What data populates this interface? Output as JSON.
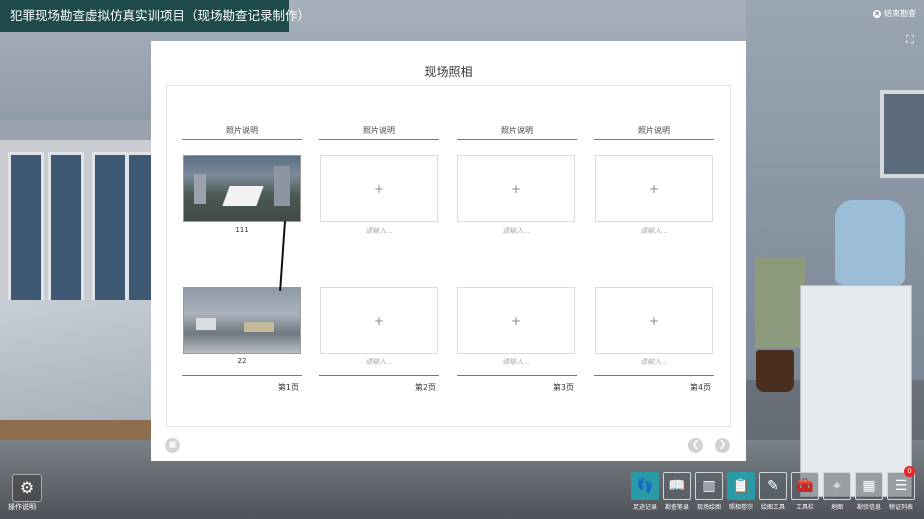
{
  "app": {
    "title": "犯罪现场勘查虚拟仿真实训项目（现场勘查记录制作）",
    "end_label": "结束勘查"
  },
  "panel": {
    "title": "现场照相",
    "columns": [
      {
        "header": "照片说明",
        "page": "第1页",
        "photos": [
          {
            "caption": "111",
            "filled": true
          },
          {
            "caption": "22",
            "filled": true
          }
        ]
      },
      {
        "header": "照片说明",
        "page": "第2页",
        "photos": [
          {
            "caption": "请输入...",
            "filled": false
          },
          {
            "caption": "请输入...",
            "filled": false
          }
        ]
      },
      {
        "header": "照片说明",
        "page": "第3页",
        "photos": [
          {
            "caption": "请输入...",
            "filled": false
          },
          {
            "caption": "请输入...",
            "filled": false
          }
        ]
      },
      {
        "header": "照片说明",
        "page": "第4页",
        "photos": [
          {
            "caption": "请输入...",
            "filled": false
          },
          {
            "caption": "请输入...",
            "filled": false
          }
        ]
      }
    ],
    "add_symbol": "+"
  },
  "bottom_left": {
    "label": "操作说明",
    "icon": "gear-icon"
  },
  "toolbar": [
    {
      "label": "足迹记录",
      "icon": "footprint-icon",
      "active": true
    },
    {
      "label": "勘查笔录",
      "icon": "book-icon",
      "active": false
    },
    {
      "label": "现场绘图",
      "icon": "chart-icon",
      "active": false
    },
    {
      "label": "照相卷宗",
      "icon": "clipboard-icon",
      "active": true
    },
    {
      "label": "绘图工具",
      "icon": "pencil-icon",
      "active": false
    },
    {
      "label": "工具栏",
      "icon": "toolbox-icon",
      "active": false
    },
    {
      "label": "地图",
      "icon": "map-pin-icon",
      "active": false
    },
    {
      "label": "勘验信息",
      "icon": "grid-icon",
      "active": false
    },
    {
      "label": "物证列表",
      "icon": "list-icon",
      "active": false,
      "badge": "0"
    }
  ]
}
